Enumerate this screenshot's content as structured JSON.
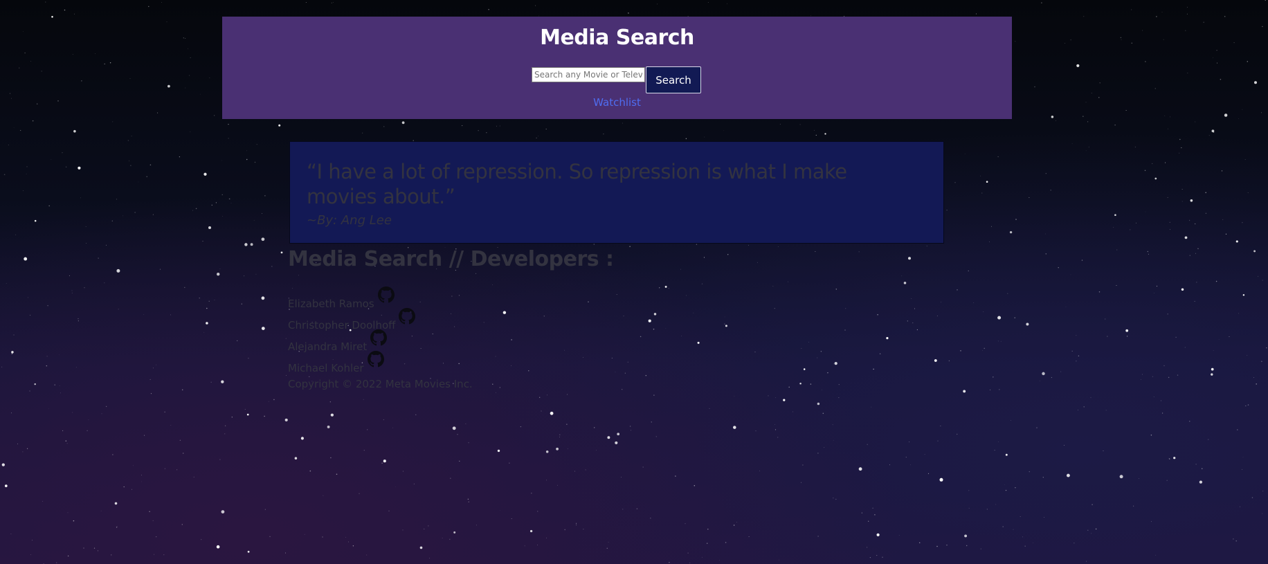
{
  "header": {
    "title": "Media Search",
    "search_placeholder": "Search any Movie or Television",
    "search_button_label": "Search",
    "watchlist_label": "Watchlist"
  },
  "quote": {
    "text": "“I have a lot of repression. So repression is what I make movies about.”",
    "author": "~By: Ang Lee"
  },
  "developers": {
    "heading": "Media Search // Developers :",
    "list": [
      {
        "name": "Elizabeth Ramos",
        "icon": "github-icon"
      },
      {
        "name": "Christopher Doolhoff",
        "icon": "github-icon"
      },
      {
        "name": "Alejandra Miret",
        "icon": "github-icon"
      },
      {
        "name": "Michael Kohler",
        "icon": "github-icon"
      }
    ]
  },
  "footer": {
    "copyright": "Copyright © 2022 Meta Movies Inc."
  },
  "colors": {
    "header_bg": "#4a3073",
    "quote_bg": "#131955",
    "button_bg": "#121a54",
    "link": "#4f6df0",
    "muted_text": "#333340"
  }
}
